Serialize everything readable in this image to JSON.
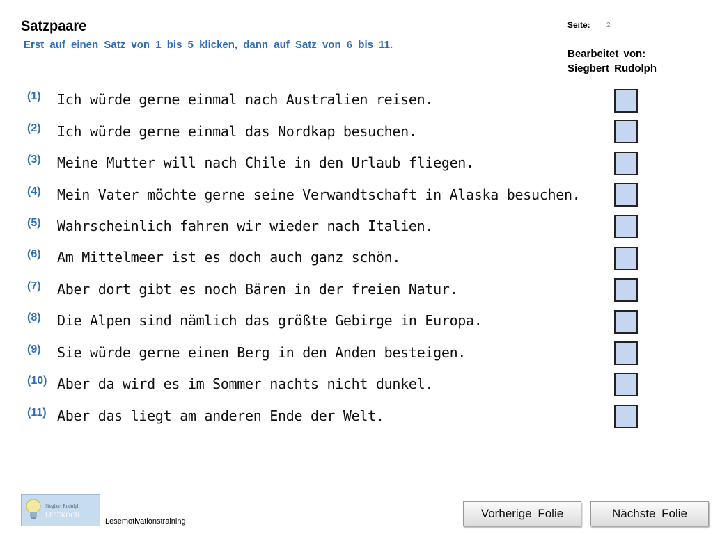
{
  "header": {
    "title": "Satzpaare",
    "instruction": "Erst auf einen Satz von 1 bis 5 klicken, dann auf Satz von 6 bis 11.",
    "page_label": "Seite:",
    "page_number": "2",
    "editor_line1": "Bearbeitet von:",
    "editor_line2": "Siegbert Rudolph"
  },
  "sentences": [
    {
      "num": "(1)",
      "text": "Ich würde gerne einmal nach Australien reisen."
    },
    {
      "num": "(2)",
      "text": "Ich würde gerne einmal das Nordkap besuchen."
    },
    {
      "num": "(3)",
      "text": "Meine Mutter will nach Chile in den Urlaub fliegen."
    },
    {
      "num": "(4)",
      "text": "Mein Vater möchte gerne seine Verwandtschaft in Alaska besuchen."
    },
    {
      "num": "(5)",
      "text": "Wahrscheinlich fahren wir wieder nach Italien."
    },
    {
      "num": "(6)",
      "text": "Am Mittelmeer ist es doch auch ganz schön."
    },
    {
      "num": "(7)",
      "text": "Aber dort gibt es noch Bären in der freien Natur."
    },
    {
      "num": "(8)",
      "text": "Die Alpen sind nämlich das größte Gebirge in Europa."
    },
    {
      "num": "(9)",
      "text": "Sie würde gerne einen Berg in den Anden besteigen."
    },
    {
      "num": "(10)",
      "text": "Aber da wird es im Sommer nachts nicht dunkel."
    },
    {
      "num": "(11)",
      "text": "Aber das liegt am anderen Ende der Welt."
    }
  ],
  "footer": {
    "logo_name": "Siegbert Rudolph",
    "logo_brand": "LESEKOCH",
    "caption": "Lesemotivationstraining",
    "prev_label": "Vorherige Folie",
    "next_label": "Nächste Folie"
  },
  "colors": {
    "accent_blue": "#2f6db5",
    "box_fill": "#c5d7f0",
    "box_border": "#222222",
    "rule": "#4a7ebf"
  }
}
